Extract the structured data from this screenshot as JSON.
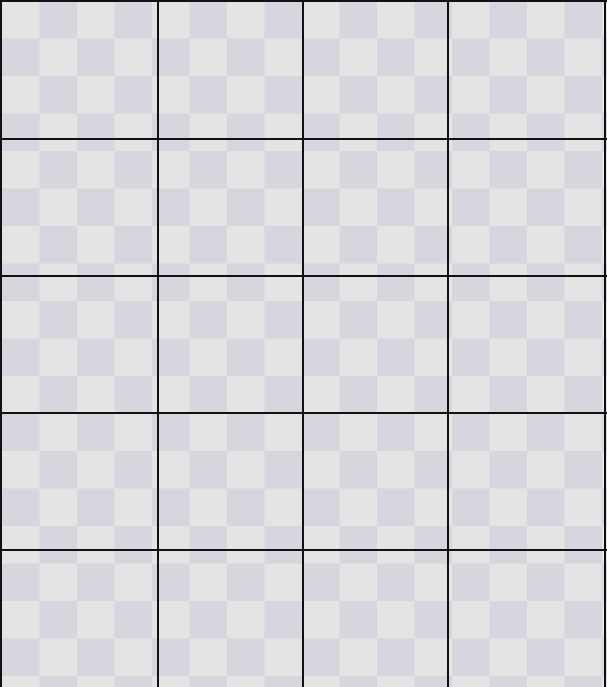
{
  "board": {
    "columns": 4,
    "rows": 5,
    "background": "transparency-checkerboard",
    "checker_light": "#e4e4e4",
    "checker_dark": "#d6d6de",
    "line_color": "#111111",
    "cells": []
  }
}
